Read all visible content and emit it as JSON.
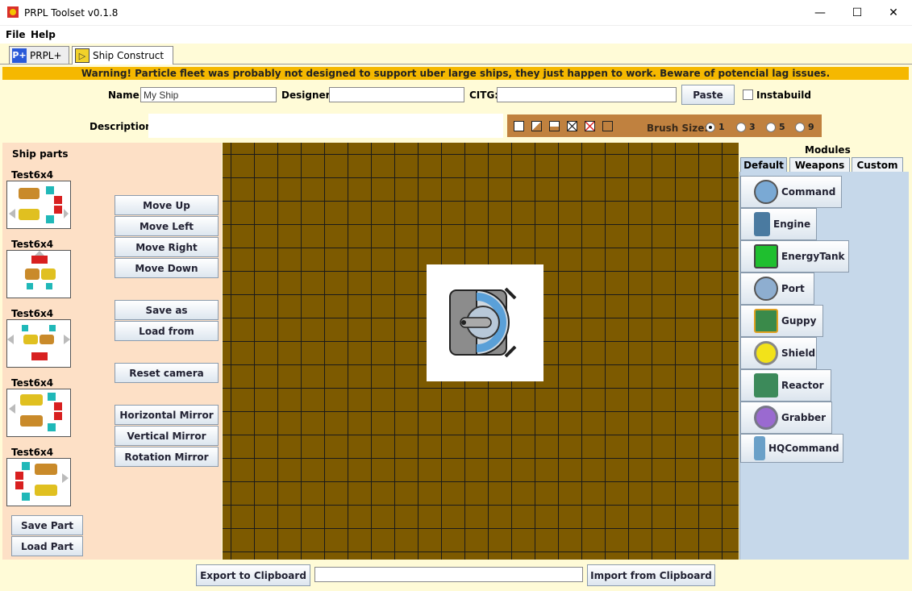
{
  "window": {
    "title": "PRPL Toolset v0.1.8"
  },
  "menu": {
    "file": "File",
    "help": "Help"
  },
  "tabs": [
    {
      "label": "PRPL+",
      "icon_text": "P+"
    },
    {
      "label": "Ship Construct",
      "icon_text": "▷"
    }
  ],
  "warning": "Warning! Particle fleet was probably not designed to support uber large ships, they just happen to work. Beware of potencial lag issues.",
  "form": {
    "name_label": "Name:",
    "name_value": "My Ship",
    "designer_label": "Designer:",
    "designer_value": "",
    "citg_label": "CITG:",
    "citg_value": "",
    "paste_label": "Paste",
    "instabuild_label": "Instabuild",
    "description_label": "Description:",
    "description_value": ""
  },
  "brush": {
    "label": "Brush Size:",
    "sizes": [
      "1",
      "3",
      "5",
      "9"
    ],
    "selected": "1"
  },
  "ship_parts": {
    "title": "Ship parts",
    "parts": [
      {
        "name": "Test6x4"
      },
      {
        "name": "Test6x4"
      },
      {
        "name": "Test6x4"
      },
      {
        "name": "Test6x4"
      },
      {
        "name": "Test6x4"
      }
    ],
    "save_part": "Save Part",
    "load_part": "Load Part"
  },
  "actions": {
    "move_up": "Move Up",
    "move_left": "Move Left",
    "move_right": "Move Right",
    "move_down": "Move Down",
    "save_as": "Save as",
    "load_from": "Load from",
    "reset_camera": "Reset camera",
    "horizontal_mirror": "Horizontal Mirror",
    "vertical_mirror": "Vertical Mirror",
    "rotation_mirror": "Rotation Mirror"
  },
  "modules": {
    "title": "Modules",
    "tabs": [
      "Default",
      "Weapons",
      "Custom"
    ],
    "items": [
      {
        "label": "Command",
        "icon": "command-icon",
        "color": "#7aa9d4"
      },
      {
        "label": "Engine",
        "icon": "engine-icon",
        "color": "#4a7aa0"
      },
      {
        "label": "EnergyTank",
        "icon": "energytank-icon",
        "color": "#1fbf2f"
      },
      {
        "label": "Port",
        "icon": "port-icon",
        "color": "#8eaed0"
      },
      {
        "label": "Guppy",
        "icon": "guppy-icon",
        "color": "#e0a020"
      },
      {
        "label": "Shield",
        "icon": "shield-icon",
        "color": "#f2e21a"
      },
      {
        "label": "Reactor",
        "icon": "reactor-icon",
        "color": "#3c8a5a"
      },
      {
        "label": "Grabber",
        "icon": "grabber-icon",
        "color": "#9a6ad0"
      },
      {
        "label": "HQCommand",
        "icon": "hqcommand-icon",
        "color": "#6aa0c8"
      }
    ]
  },
  "bottom": {
    "export_label": "Export to Clipboard",
    "clipboard_value": "",
    "import_label": "Import from Clipboard"
  },
  "colors": {
    "background": "#fffbd7",
    "warning": "#f5b800",
    "grid": "#7d5a00",
    "left_panel": "#fde0c6",
    "modules_panel": "#c6d8ea",
    "brush_bar": "#c0813f"
  }
}
